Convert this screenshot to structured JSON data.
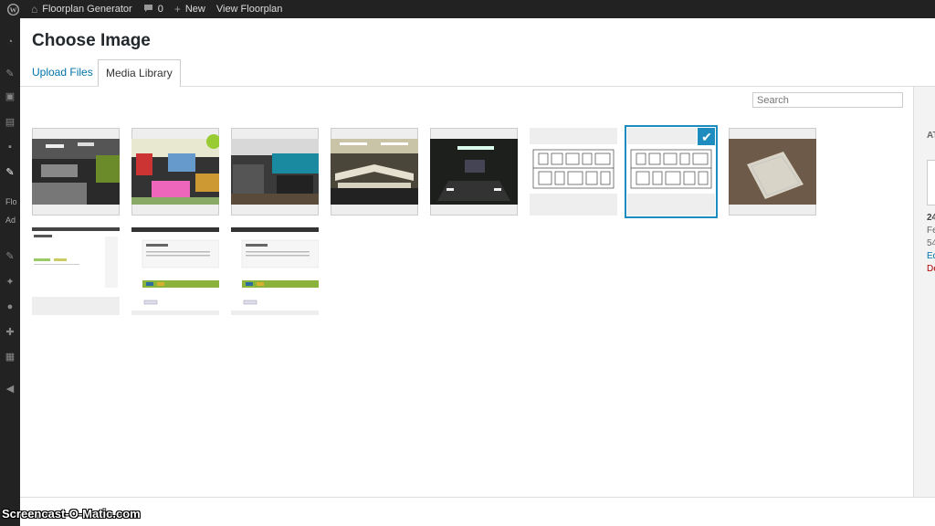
{
  "adminbar": {
    "site_name": "Floorplan Generator",
    "comments_count": "0",
    "new_label": "New",
    "view_label": "View Floorplan"
  },
  "sidemenu": {
    "partial_labels": [
      "Flo",
      "Ad"
    ]
  },
  "modal": {
    "title": "Choose Image",
    "tabs": [
      {
        "label": "Upload Files",
        "active": false
      },
      {
        "label": "Media Library",
        "active": true
      }
    ],
    "search_placeholder": "Search"
  },
  "media_items": [
    {
      "kind": "photo-lab",
      "selected": false
    },
    {
      "kind": "photo-colorful-room",
      "selected": false
    },
    {
      "kind": "photo-lounge",
      "selected": false
    },
    {
      "kind": "photo-classroom",
      "selected": false
    },
    {
      "kind": "photo-conference",
      "selected": false
    },
    {
      "kind": "floorplan",
      "selected": false
    },
    {
      "kind": "floorplan",
      "selected": true
    },
    {
      "kind": "photo-paper-on-floor",
      "selected": false
    },
    {
      "kind": "screenshot-admin",
      "selected": false
    },
    {
      "kind": "screenshot-editor",
      "selected": false
    },
    {
      "kind": "screenshot-editor",
      "selected": false
    }
  ],
  "details_sidebar": {
    "heading_partial": "AT",
    "filename_partial": "24",
    "date_partial": "Fe",
    "size_partial": "54",
    "edit_partial": "Ed",
    "delete_partial": "De"
  },
  "colors": {
    "accent": "#1e8cbe",
    "admin_bar": "#222222",
    "link": "#0073aa",
    "delete": "#a00000"
  },
  "watermark": "Screencast-O-Matic.com"
}
